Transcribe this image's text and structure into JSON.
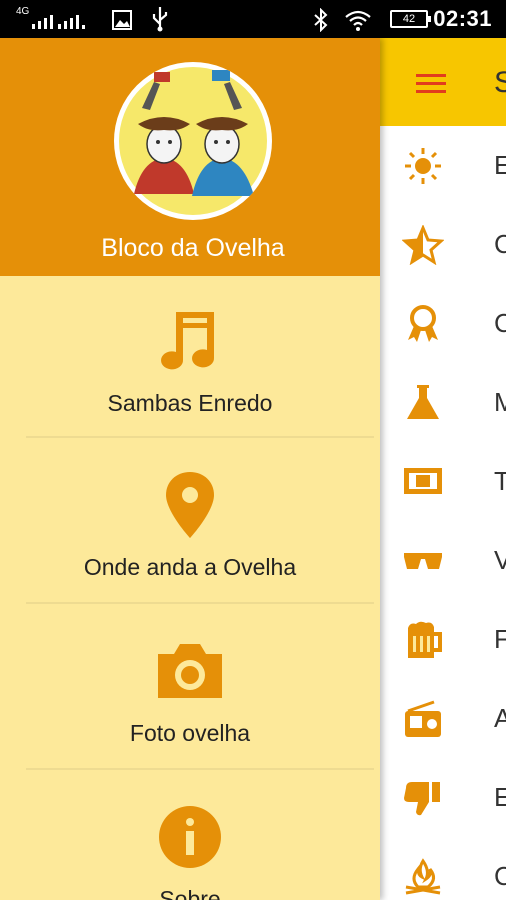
{
  "status_bar": {
    "network": "4G",
    "battery": "42",
    "time": "02:31",
    "icons": [
      "signal-icon",
      "image-icon",
      "usb-icon",
      "bluetooth-icon",
      "wifi-icon",
      "battery-icon"
    ]
  },
  "drawer": {
    "header_title": "Bloco da Ovelha",
    "colors": {
      "header": "#e59008",
      "background": "#fde99a",
      "icon": "#e59008"
    },
    "items": [
      {
        "label": "Sambas Enredo",
        "icon": "music-note-icon"
      },
      {
        "label": "Onde anda a Ovelha",
        "icon": "map-pin-icon"
      },
      {
        "label": "Foto ovelha",
        "icon": "camera-icon"
      },
      {
        "label": "Sobre",
        "icon": "info-icon"
      }
    ]
  },
  "background_app": {
    "toolbar_title": "S",
    "toolbar_color": "#f7c600",
    "items": [
      {
        "label": "E",
        "icon": "sun-icon"
      },
      {
        "label": "C",
        "icon": "star-icon"
      },
      {
        "label": "C",
        "icon": "award-ribbon-icon"
      },
      {
        "label": "M",
        "icon": "flask-icon"
      },
      {
        "label": "T",
        "icon": "money-icon"
      },
      {
        "label": "V",
        "icon": "sunglasses-icon"
      },
      {
        "label": "F",
        "icon": "beer-mug-icon"
      },
      {
        "label": "A",
        "icon": "radio-icon"
      },
      {
        "label": "E",
        "icon": "thumbs-down-icon"
      },
      {
        "label": "C",
        "icon": "campfire-icon"
      }
    ]
  }
}
